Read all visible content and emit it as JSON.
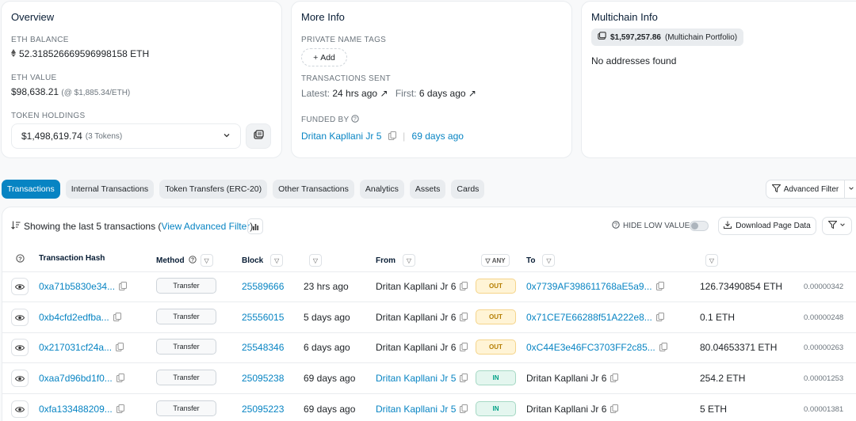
{
  "overview": {
    "title": "Overview",
    "eth_balance_label": "ETH BALANCE",
    "eth_balance": "52.318526669596998158 ETH",
    "eth_value_label": "ETH VALUE",
    "eth_value": "$98,638.21",
    "eth_price": "(@ $1,885.34/ETH)",
    "token_holdings_label": "TOKEN HOLDINGS",
    "token_value": "$1,498,619.74",
    "token_count": "(3 Tokens)"
  },
  "more_info": {
    "title": "More Info",
    "private_tags_label": "PRIVATE NAME TAGS",
    "add_label": "Add",
    "tx_sent_label": "TRANSACTIONS SENT",
    "latest_label": "Latest:",
    "latest_value": "24 hrs ago",
    "first_label": "First:",
    "first_value": "6 days ago",
    "funded_by_label": "FUNDED BY",
    "funded_by": "Dritan Kapllani Jr 5",
    "funded_when": "69 days ago"
  },
  "multichain": {
    "title": "Multichain Info",
    "portfolio": "$1,597,257.86",
    "portfolio_suffix": "(Multichain Portfolio)",
    "no_addresses": "No addresses found"
  },
  "tabs": [
    "Transactions",
    "Internal Transactions",
    "Token Transfers (ERC-20)",
    "Other Transactions",
    "Analytics",
    "Assets",
    "Cards"
  ],
  "advanced_filter": "Advanced Filter",
  "summary": {
    "text": "Showing the last 5 transactions (",
    "link": "View Advanced Filter",
    "close": ")"
  },
  "hide_low_value": "HIDE LOW VALUE",
  "download": "Download Page Data",
  "headers": {
    "hash": "Transaction Hash",
    "method": "Method",
    "block": "Block",
    "from": "From",
    "any": "ANY",
    "to": "To"
  },
  "rows": [
    {
      "hash": "0xa71b5830e34...",
      "method": "Transfer",
      "block": "25589666",
      "age": "23 hrs ago",
      "from": "Dritan Kapllani Jr 6",
      "dir": "OUT",
      "to": "0x7739AF398611768aE5a9...",
      "amount": "126.73490854 ETH",
      "fee": "0.00000342"
    },
    {
      "hash": "0xb4cfd2edfba...",
      "method": "Transfer",
      "block": "25556015",
      "age": "5 days ago",
      "from": "Dritan Kapllani Jr 6",
      "dir": "OUT",
      "to": "0x71CE7E66288f51A222e8...",
      "amount": "0.1 ETH",
      "fee": "0.00000248"
    },
    {
      "hash": "0x217031cf24a...",
      "method": "Transfer",
      "block": "25548346",
      "age": "6 days ago",
      "from": "Dritan Kapllani Jr 6",
      "dir": "OUT",
      "to": "0xC44E3e46FC3703FF2c85...",
      "amount": "80.04653371 ETH",
      "fee": "0.00000263"
    },
    {
      "hash": "0xaa7d96bd1f0...",
      "method": "Transfer",
      "block": "25095238",
      "age": "69 days ago",
      "from": "Dritan Kapllani Jr 5",
      "dir": "IN",
      "to": "Dritan Kapllani Jr 6",
      "amount": "254.2 ETH",
      "fee": "0.00001253"
    },
    {
      "hash": "0xfa133488209...",
      "method": "Transfer",
      "block": "25095223",
      "age": "69 days ago",
      "from": "Dritan Kapllani Jr 5",
      "dir": "IN",
      "to": "Dritan Kapllani Jr 6",
      "amount": "5 ETH",
      "fee": "0.00001381"
    }
  ]
}
